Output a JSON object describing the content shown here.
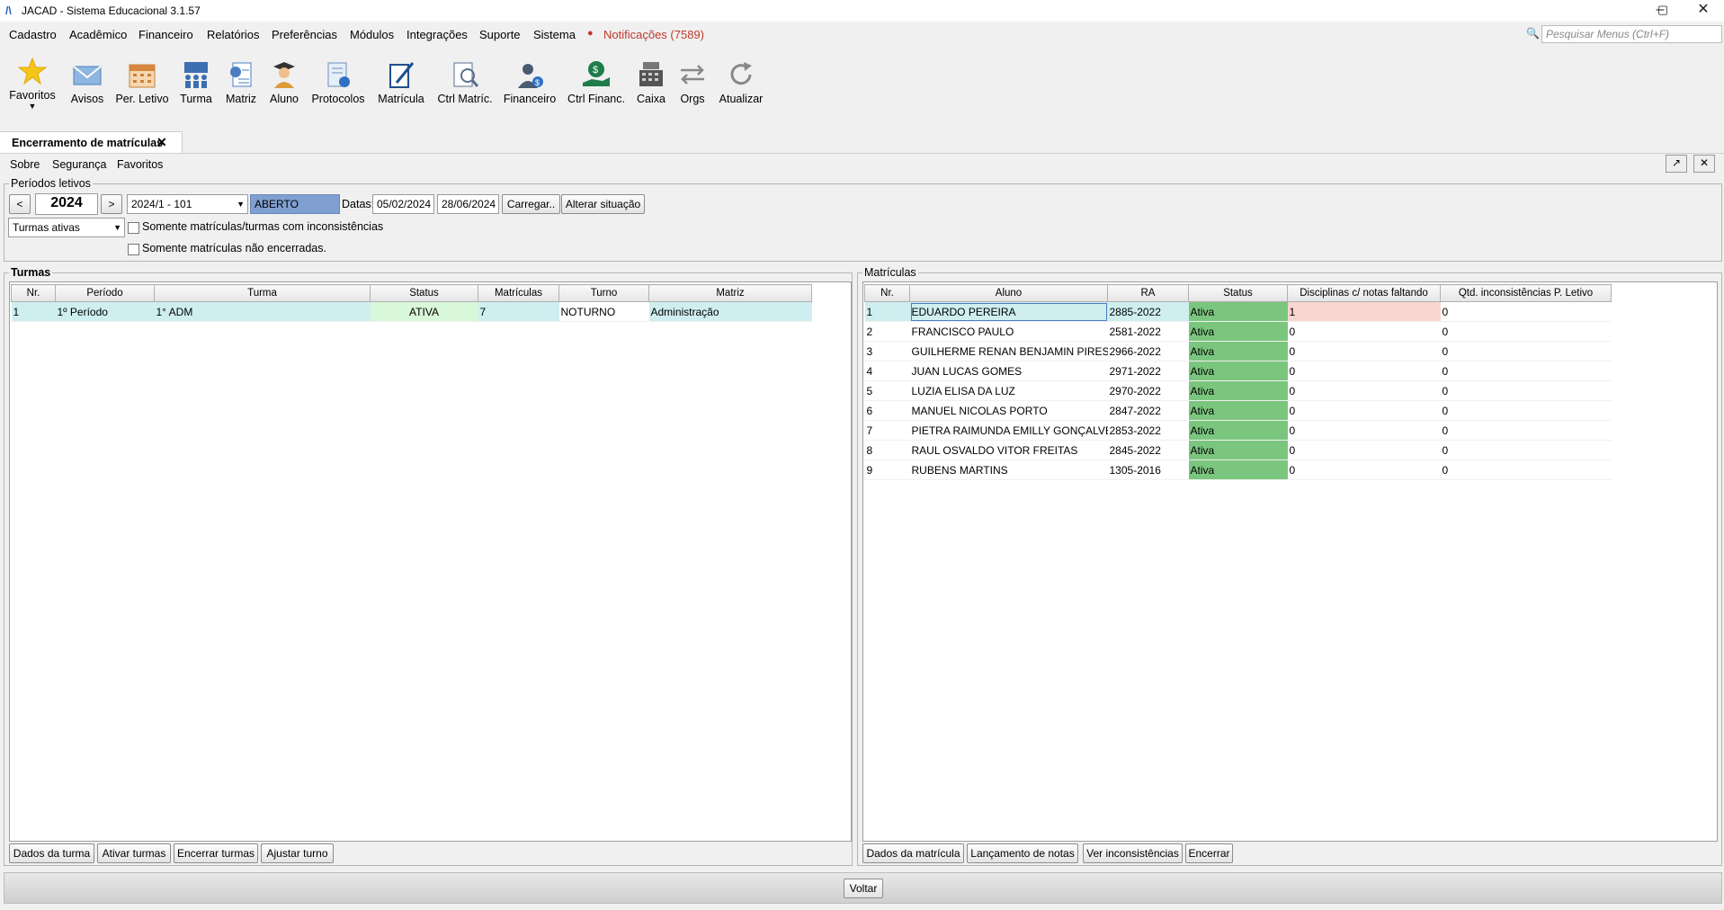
{
  "window": {
    "title": "JACAD - Sistema Educacional 3.1.57",
    "controls": [
      "minimize-icon",
      "maximize-icon",
      "close-icon"
    ]
  },
  "menu": {
    "items": [
      "Cadastro",
      "Acadêmico",
      "Financeiro",
      "Relatórios",
      "Preferências",
      "Módulos",
      "Integrações",
      "Suporte",
      "Sistema"
    ],
    "notifications": "Notificações (7589)",
    "search_placeholder": "Pesquisar Menus (Ctrl+F)"
  },
  "toolbar": {
    "items": [
      {
        "label": "Favoritos",
        "icon": "star-icon"
      },
      {
        "label": "Avisos",
        "icon": "envelope-icon"
      },
      {
        "label": "Per. Letivo",
        "icon": "calendar-icon"
      },
      {
        "label": "Turma",
        "icon": "class-group-icon"
      },
      {
        "label": "Matriz",
        "icon": "matrix-icon"
      },
      {
        "label": "Aluno",
        "icon": "student-icon"
      },
      {
        "label": "Protocolos",
        "icon": "protocol-icon"
      },
      {
        "label": "Matrícula",
        "icon": "enrollment-icon"
      },
      {
        "label": "Ctrl Matríc.",
        "icon": "enrollment-control-icon"
      },
      {
        "label": "Financeiro",
        "icon": "finance-person-icon"
      },
      {
        "label": "Ctrl Financ.",
        "icon": "money-hand-icon"
      },
      {
        "label": "Caixa",
        "icon": "cash-register-icon"
      },
      {
        "label": "Orgs",
        "icon": "arrows-icon"
      },
      {
        "label": "Atualizar",
        "icon": "refresh-icon"
      }
    ]
  },
  "tab": {
    "label": "Encerramento de matrículas"
  },
  "submenu": {
    "items": [
      "Sobre",
      "Segurança",
      "Favoritos"
    ]
  },
  "periodos": {
    "title": "Períodos letivos",
    "year": "2024",
    "period_select": "2024/1 - 101",
    "situation": "ABERTO",
    "dates_label": "Datas:",
    "date_start": "05/02/2024",
    "date_end": "28/06/2024",
    "load_button": "Carregar..",
    "change_button": "Alterar situação",
    "filter_select": "Turmas ativas",
    "check_inconsistencias": "Somente matrículas/turmas com inconsistências",
    "check_nao_encerradas": "Somente matrículas não encerradas."
  },
  "turmas": {
    "title": "Turmas",
    "columns": [
      "Nr.",
      "Período",
      "Turma",
      "Status",
      "Matrículas",
      "Turno",
      "Matriz"
    ],
    "rows": [
      [
        "1",
        "1º Período",
        "1° ADM",
        "ATIVA",
        "7",
        "NOTURNO",
        "Administração"
      ]
    ],
    "buttons": [
      "Dados da turma",
      "Ativar turmas",
      "Encerrar turmas",
      "Ajustar turno"
    ]
  },
  "matriculas": {
    "title": "Matrículas",
    "columns": [
      "Nr.",
      "Aluno",
      "RA",
      "Status",
      "Disciplinas c/ notas faltando",
      "Qtd. inconsistências P. Letivo"
    ],
    "rows": [
      [
        "1",
        "EDUARDO PEREIRA",
        "2885-2022",
        "Ativa",
        "1",
        "0"
      ],
      [
        "2",
        "FRANCISCO PAULO",
        "2581-2022",
        "Ativa",
        "0",
        "0"
      ],
      [
        "3",
        "GUILHERME RENAN BENJAMIN PIRES",
        "2966-2022",
        "Ativa",
        "0",
        "0"
      ],
      [
        "4",
        "JUAN LUCAS GOMES",
        "2971-2022",
        "Ativa",
        "0",
        "0"
      ],
      [
        "5",
        "LUZIA ELISA DA LUZ",
        "2970-2022",
        "Ativa",
        "0",
        "0"
      ],
      [
        "6",
        "MANUEL NICOLAS PORTO",
        "2847-2022",
        "Ativa",
        "0",
        "0"
      ],
      [
        "7",
        "PIETRA RAIMUNDA EMILLY GONÇALVES",
        "2853-2022",
        "Ativa",
        "0",
        "0"
      ],
      [
        "8",
        "RAUL OSVALDO VITOR FREITAS",
        "2845-2022",
        "Ativa",
        "0",
        "0"
      ],
      [
        "9",
        "RUBENS MARTINS",
        "1305-2016",
        "Ativa",
        "0",
        "0"
      ]
    ],
    "buttons": [
      "Dados da matrícula",
      "Lançamento de notas",
      "Ver inconsistências",
      "Encerrar"
    ]
  },
  "footer": {
    "back_button": "Voltar"
  },
  "colors": {
    "status_active": "#7bc67e",
    "selected_row": "#cfeef0",
    "missing_grades": "#f9d6cf",
    "situation_bg": "#7f9fd0",
    "notif": "#c0392b"
  }
}
